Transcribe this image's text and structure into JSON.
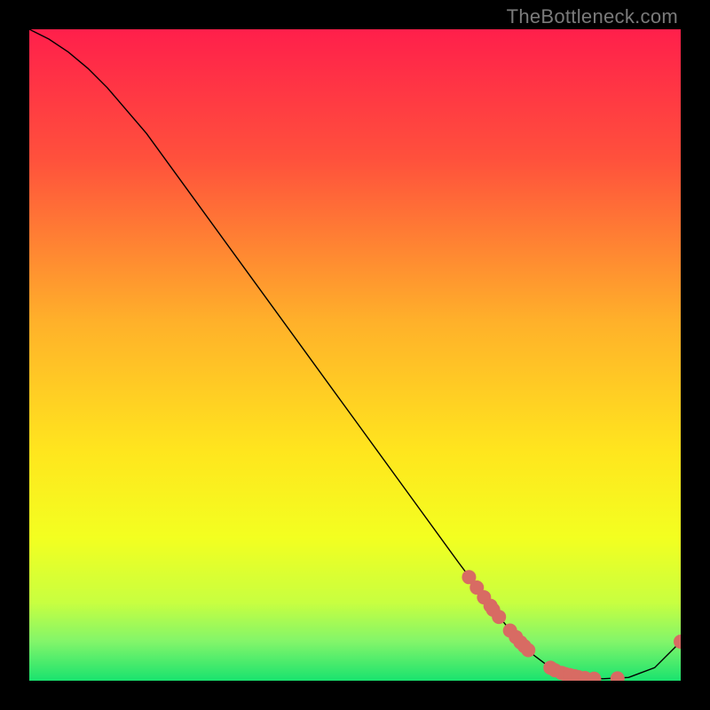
{
  "watermark": "TheBottleneck.com",
  "chart_data": {
    "type": "line",
    "title": "",
    "xlabel": "",
    "ylabel": "",
    "xlim": [
      0,
      100
    ],
    "ylim": [
      0,
      100
    ],
    "grid": false,
    "legend": false,
    "background": {
      "type": "vertical-gradient",
      "stops": [
        {
          "pos": 0.0,
          "color": "#ff1f4b"
        },
        {
          "pos": 0.2,
          "color": "#ff513c"
        },
        {
          "pos": 0.45,
          "color": "#ffb12a"
        },
        {
          "pos": 0.65,
          "color": "#ffe61e"
        },
        {
          "pos": 0.78,
          "color": "#f3ff20"
        },
        {
          "pos": 0.88,
          "color": "#c8ff40"
        },
        {
          "pos": 0.94,
          "color": "#82f56a"
        },
        {
          "pos": 1.0,
          "color": "#19e36e"
        }
      ]
    },
    "series": [
      {
        "name": "bottleneck-curve",
        "stroke": "#000000",
        "stroke_width": 1.4,
        "x": [
          0,
          3,
          6,
          9,
          12,
          18,
          26,
          34,
          42,
          50,
          58,
          66,
          72,
          76,
          80,
          84,
          88,
          92,
          96,
          100
        ],
        "y": [
          100,
          98.5,
          96.5,
          94,
          91,
          84,
          73,
          62,
          51,
          40,
          29,
          18,
          10,
          5,
          2,
          0.8,
          0.3,
          0.5,
          2,
          6
        ]
      }
    ],
    "markers": {
      "color": "#d86b63",
      "radius": 8,
      "x": [
        67.5,
        68.7,
        69.8,
        70.8,
        71.2,
        72.1,
        73.8,
        74.7,
        75.4,
        76.0,
        76.6,
        80.0,
        80.7,
        81.7,
        82.3,
        83.0,
        83.7,
        84.3,
        85.3,
        86.7,
        90.3,
        100.0
      ],
      "y": [
        15.9,
        14.3,
        12.8,
        11.5,
        10.9,
        9.8,
        7.7,
        6.7,
        5.9,
        5.3,
        4.7,
        2.0,
        1.6,
        1.2,
        1.0,
        0.85,
        0.7,
        0.55,
        0.4,
        0.3,
        0.35,
        6.0
      ]
    }
  }
}
